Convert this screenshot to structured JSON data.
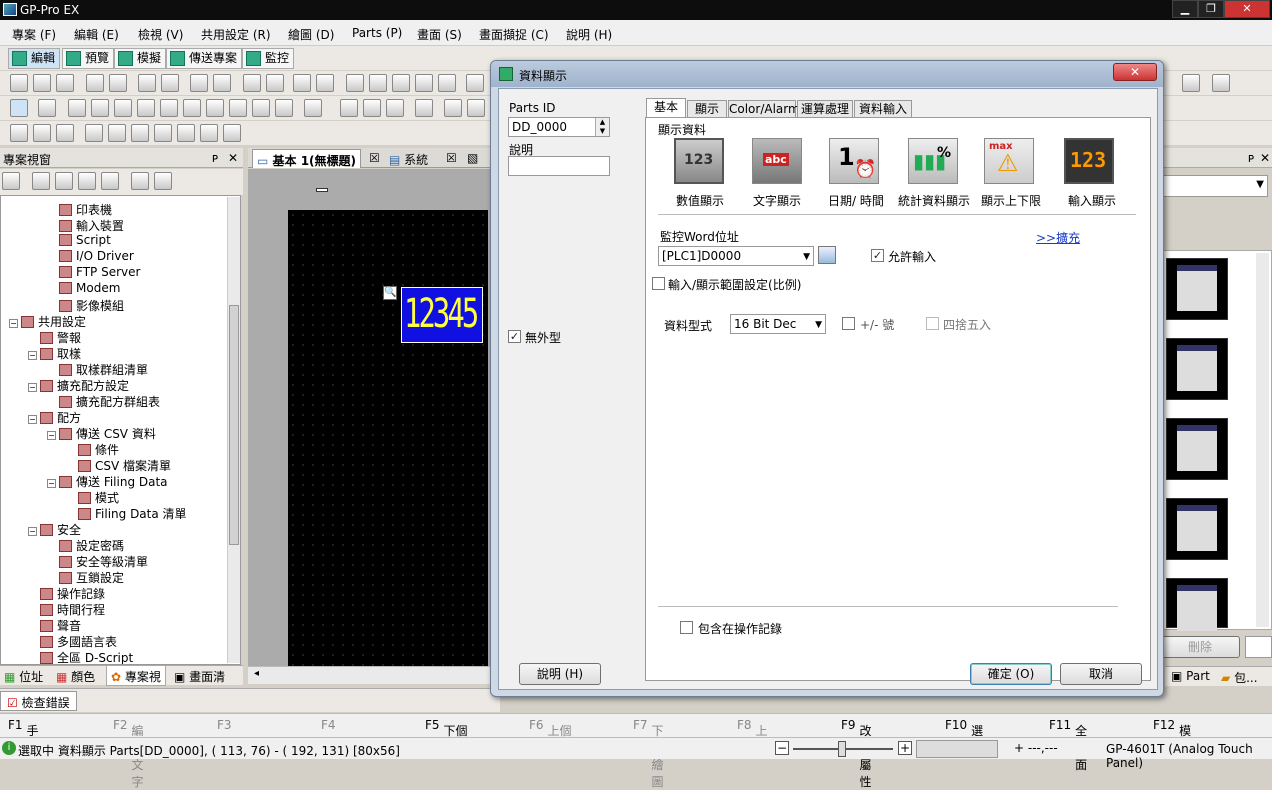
{
  "app": {
    "title": "GP-Pro EX"
  },
  "menu": [
    "專案 (F)",
    "編輯 (E)",
    "檢視 (V)",
    "共用設定 (R)",
    "繪圖 (D)",
    "Parts (P)",
    "畫面 (S)",
    "畫面擷捉 (C)",
    "說明 (H)"
  ],
  "modes": [
    "編輯",
    "預覽",
    "模擬",
    "傳送專案",
    "監控"
  ],
  "project_panel": {
    "title": "專案視窗",
    "pin": "ᴘ",
    "close": "✕"
  },
  "tree": [
    {
      "label": "印表機",
      "indent": 2
    },
    {
      "label": "輸入裝置",
      "indent": 2
    },
    {
      "label": "Script",
      "indent": 2
    },
    {
      "label": "I/O Driver",
      "indent": 2
    },
    {
      "label": "FTP Server",
      "indent": 2
    },
    {
      "label": "Modem",
      "indent": 2
    },
    {
      "label": "影像模組",
      "indent": 2
    },
    {
      "label": "共用設定",
      "indent": 0,
      "exp": "−"
    },
    {
      "label": "警報",
      "indent": 1
    },
    {
      "label": "取樣",
      "indent": 1,
      "exp": "−"
    },
    {
      "label": "取樣群組清單",
      "indent": 2
    },
    {
      "label": "擴充配方設定",
      "indent": 1,
      "exp": "−"
    },
    {
      "label": "擴充配方群組表",
      "indent": 2
    },
    {
      "label": "配方",
      "indent": 1,
      "exp": "−"
    },
    {
      "label": "傳送 CSV 資料",
      "indent": 2,
      "exp": "−"
    },
    {
      "label": "條件",
      "indent": 3
    },
    {
      "label": "CSV 檔案清單",
      "indent": 3
    },
    {
      "label": "傳送 Filing Data",
      "indent": 2,
      "exp": "−"
    },
    {
      "label": "模式",
      "indent": 3
    },
    {
      "label": "Filing Data 清單",
      "indent": 3
    },
    {
      "label": "安全",
      "indent": 1,
      "exp": "−"
    },
    {
      "label": "設定密碼",
      "indent": 2
    },
    {
      "label": "安全等級清單",
      "indent": 2
    },
    {
      "label": "互鎖設定",
      "indent": 2
    },
    {
      "label": "操作記錄",
      "indent": 1
    },
    {
      "label": "時間行程",
      "indent": 1
    },
    {
      "label": "聲音",
      "indent": 1
    },
    {
      "label": "多國語言表",
      "indent": 1
    },
    {
      "label": "全區 D-Script",
      "indent": 1
    }
  ],
  "bottom_tabs": [
    "位址",
    "顏色",
    "專案視",
    "畫面清"
  ],
  "doc_tabs": [
    "基本 1(無標題)",
    "系統"
  ],
  "canvas_part": {
    "value": "12345"
  },
  "error_tab": "檢查錯誤",
  "dialog": {
    "title": "資料顯示",
    "parts_id_label": "Parts ID",
    "parts_id_value": "DD_0000",
    "comment_label": "說明",
    "no_frame_label": "無外型",
    "no_frame_checked": "✓",
    "tabs": [
      "基本",
      "顯示",
      "Color/Alarm",
      "運算處理",
      "資料輸入"
    ],
    "display_data_label": "顯示資料",
    "types": [
      "數值顯示",
      "文字顯示",
      "日期/ 時間",
      "統計資料顯示",
      "顯示上下限",
      "輸入顯示"
    ],
    "monitor_label": "監控Word位址",
    "monitor_value": "[PLC1]D0000",
    "expand_link": ">>擴充",
    "allow_input_label": "允許輸入",
    "allow_input_checked": "✓",
    "range_label": "輸入/顯示範圍設定(比例)",
    "data_type_label": "資料型式",
    "data_type_value": "16 Bit Dec",
    "sign_label": "+/- 號",
    "round_label": "四捨五入",
    "oplog_label": "包含在操作記錄",
    "help_button": "說明 (H)",
    "ok_button": "確定 (O)",
    "cancel_button": "取消"
  },
  "right_panel": {
    "delete_label": "刪除",
    "tabs": [
      "Part",
      "包..."
    ]
  },
  "fkeys": [
    {
      "key": "F1",
      "label": "手動",
      "on": true
    },
    {
      "key": "F2",
      "label": "編輯文字",
      "on": false
    },
    {
      "key": "F3",
      "label": "",
      "on": false
    },
    {
      "key": "F4",
      "label": "",
      "on": false
    },
    {
      "key": "F5",
      "label": "下個 Parts",
      "on": true
    },
    {
      "key": "F6",
      "label": "上個 Parts",
      "on": false
    },
    {
      "key": "F7",
      "label": "下個繪圖",
      "on": false
    },
    {
      "key": "F8",
      "label": "上個",
      "on": false
    },
    {
      "key": "F9",
      "label": "改變屬性",
      "on": true
    },
    {
      "key": "F10",
      "label": "選單",
      "on": true
    },
    {
      "key": "F11",
      "label": "全畫面",
      "on": true
    },
    {
      "key": "F12",
      "label": "模擬",
      "on": true
    }
  ],
  "status": {
    "text": "選取中  資料顯示 Parts[DD_0000], ( 113,  76) - ( 192, 131) [80x56]",
    "coord": "+ ---,---",
    "device": "GP-4601T (Analog Touch Panel)"
  },
  "colors": {
    "part_bg": "#1010e0",
    "part_text": "#ffff40",
    "link": "#1a3cc8"
  }
}
